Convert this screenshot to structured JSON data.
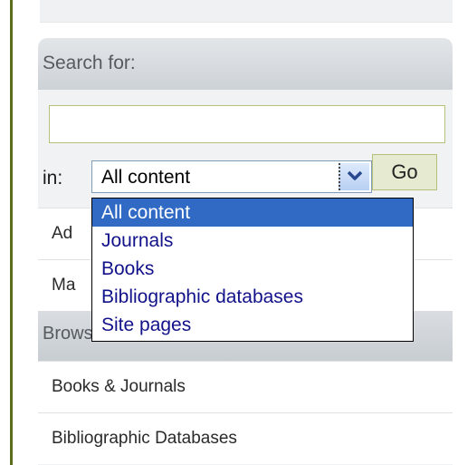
{
  "search": {
    "header": "Search for:",
    "input_value": "",
    "in_label": "in:",
    "scope_selected": "All content",
    "go_label": "Go",
    "scope_options": [
      "All content",
      "Journals",
      "Books",
      "Bibliographic databases",
      "Site pages"
    ]
  },
  "links": [
    "Ad",
    "Ma"
  ],
  "browse": {
    "header": "Browse:",
    "items": [
      "Books & Journals",
      "Bibliographic Databases"
    ]
  },
  "colors": {
    "accent_border": "#b6c07a",
    "left_rule": "#5c6e1e",
    "selection": "#316ac5",
    "option_text": "#12128a"
  },
  "icons": {
    "select_arrow": "chevron-down-icon"
  }
}
